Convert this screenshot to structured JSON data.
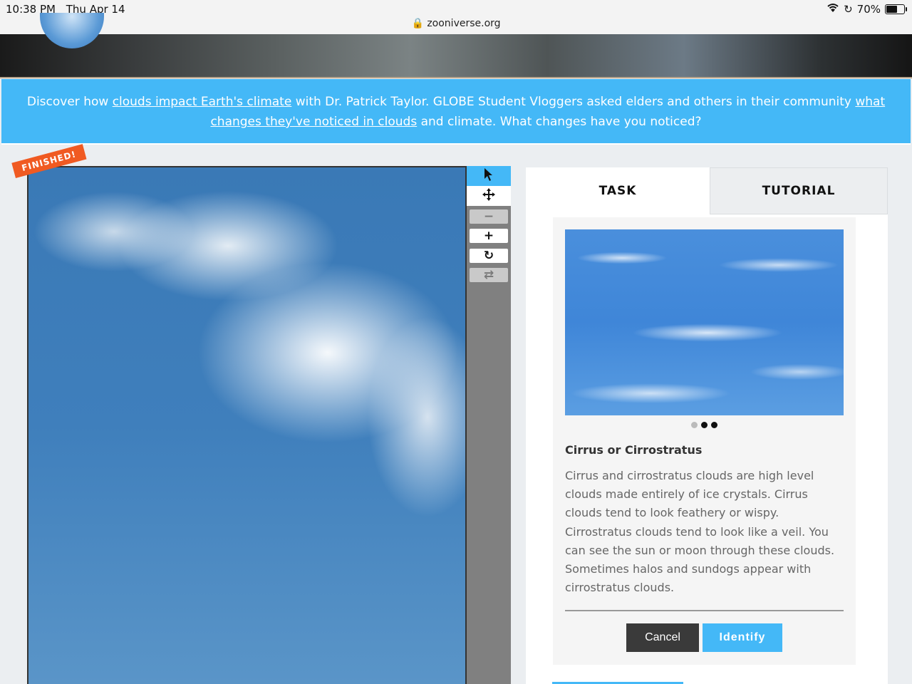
{
  "status_bar": {
    "time": "10:38 PM",
    "date": "Thu Apr 14",
    "url": "zooniverse.org",
    "battery": "70%",
    "battery_level": 0.7
  },
  "announcement": {
    "text_1": "Discover how ",
    "link_1": "clouds impact Earth's climate",
    "text_2": " with Dr. Patrick Taylor. GLOBE Student Vloggers asked elders and others in their community ",
    "link_2": "what changes they've noticed in clouds",
    "text_3": " and climate. What changes have you noticed?"
  },
  "subject": {
    "badge": "FINISHED!"
  },
  "toolbar": {
    "tools": [
      "pointer-icon",
      "move-icon",
      "zoom-out-icon",
      "zoom-in-icon",
      "rotate-icon",
      "reset-icon"
    ]
  },
  "panel": {
    "tabs": [
      "TASK",
      "TUTORIAL"
    ],
    "card": {
      "title": "Cirrus or Cirrostratus",
      "description": "Cirrus and cirrostratus clouds are high level clouds made entirely of ice crystals. Cirrus clouds tend to look feathery or wispy. Cirrostratus clouds tend to look like a veil. You can see the sun or moon through these clouds. Sometimes halos and sundogs appear with cirrostratus clouds.",
      "cancel_label": "Cancel",
      "identify_label": "Identify"
    }
  },
  "colors": {
    "accent": "#44b8f7",
    "badge": "#f05a22"
  }
}
